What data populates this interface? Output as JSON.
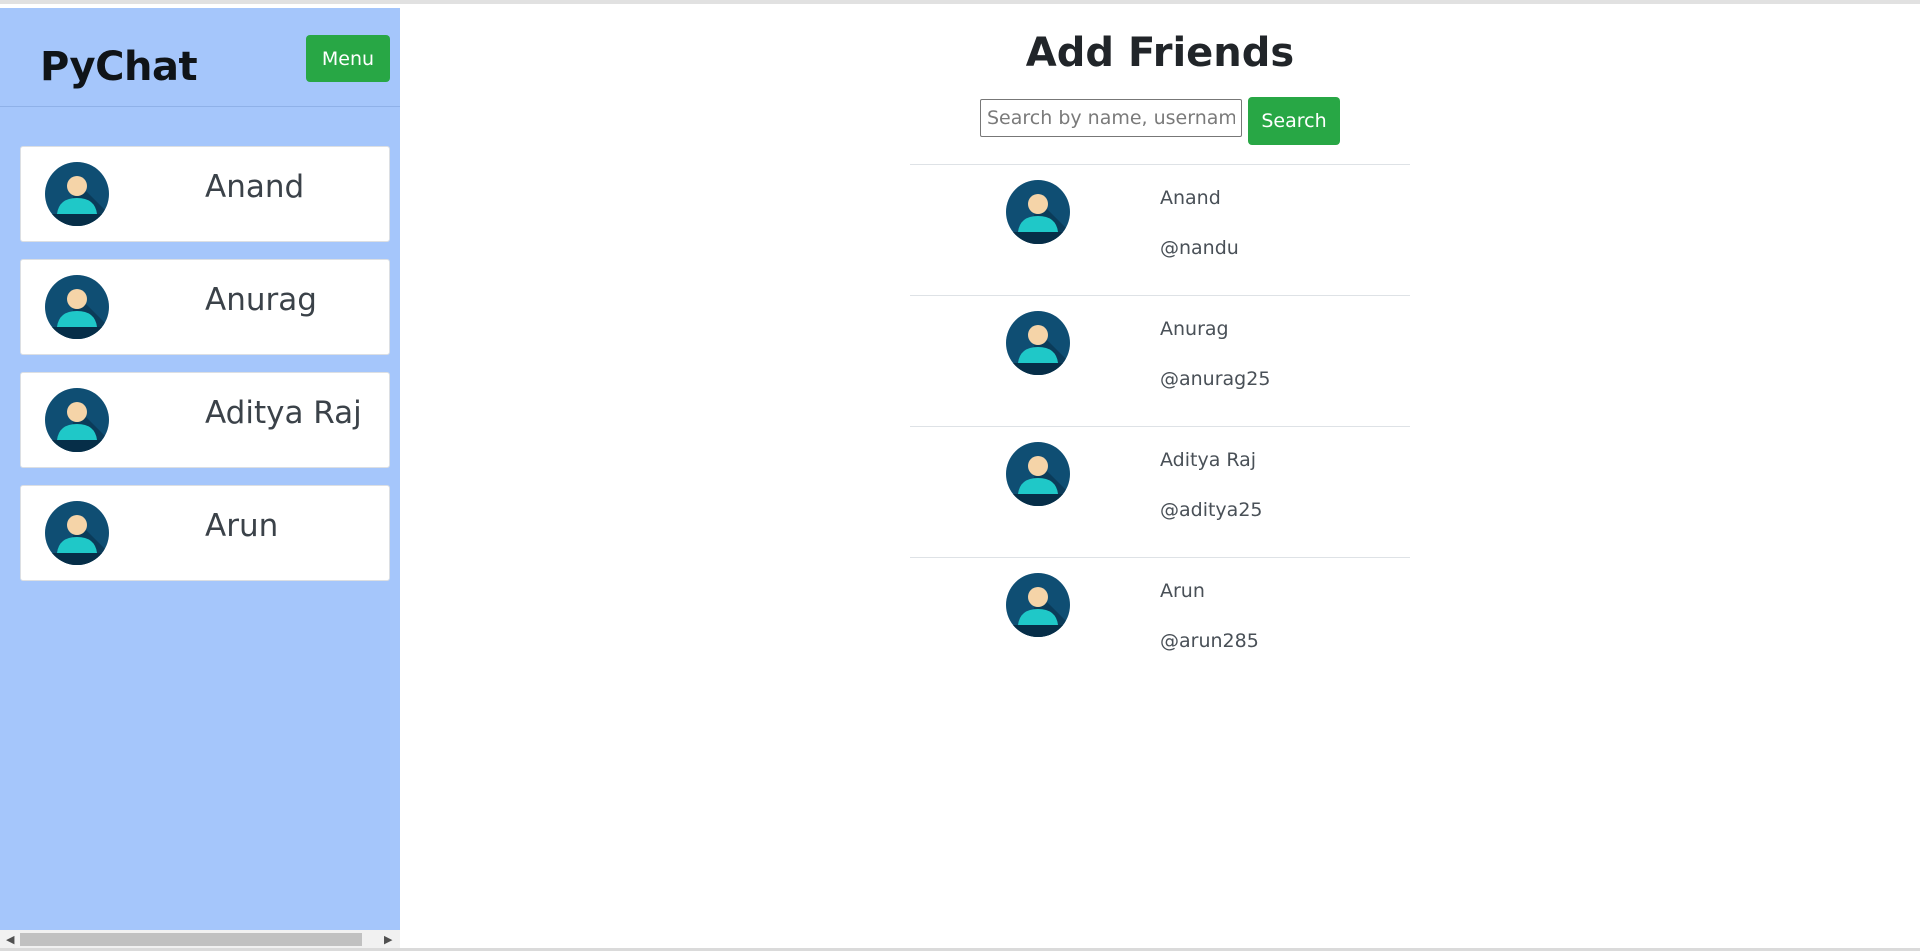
{
  "sidebar": {
    "brand": "PyChat",
    "menu_label": "Menu",
    "chats": [
      {
        "name": "Anand"
      },
      {
        "name": "Anurag"
      },
      {
        "name": "Aditya Raj"
      },
      {
        "name": "Arun"
      }
    ]
  },
  "main": {
    "title": "Add Friends",
    "search": {
      "placeholder": "Search by name, username",
      "value": "",
      "button_label": "Search"
    },
    "results": [
      {
        "name": "Anand",
        "username": "@nandu"
      },
      {
        "name": "Anurag",
        "username": "@anurag25"
      },
      {
        "name": "Aditya Raj",
        "username": "@aditya25"
      },
      {
        "name": "Arun",
        "username": "@arun285"
      }
    ]
  },
  "colors": {
    "sidebar_bg": "#a5c6fb",
    "accent_green": "#28a745",
    "avatar_bg": "#0f4e73",
    "avatar_body": "#1fc8c8",
    "avatar_head": "#f5d4a8"
  },
  "icons": {
    "avatar": "user-avatar-icon",
    "scroll_left": "scroll-left-arrow-icon",
    "scroll_right": "scroll-right-arrow-icon"
  }
}
